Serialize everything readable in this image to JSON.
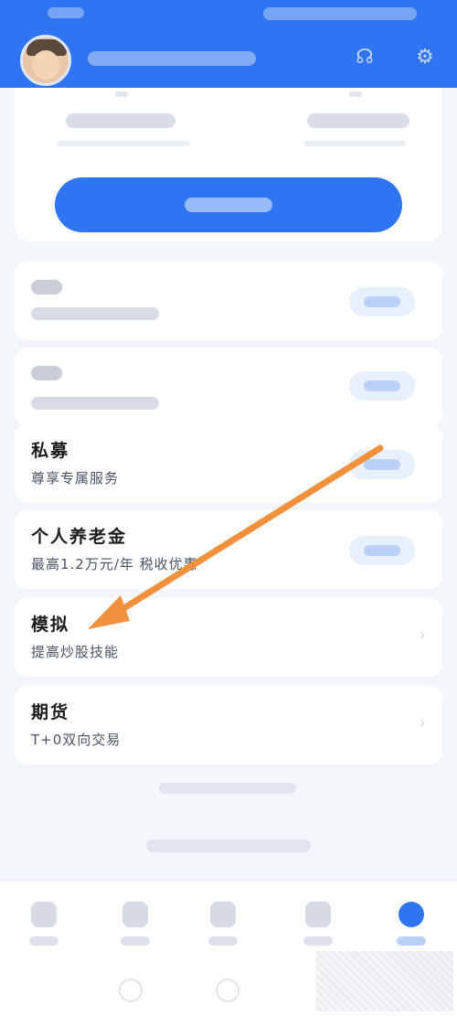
{
  "services": [
    {
      "title": "私募",
      "subtitle": "尊享专属服务"
    },
    {
      "title": "个人养老金",
      "subtitle": "最高1.2万元/年 税收优惠"
    },
    {
      "title": "模拟",
      "subtitle": "提高炒股技能"
    },
    {
      "title": "期货",
      "subtitle": "T+0双向交易"
    }
  ],
  "colors": {
    "primary": "#2f74f0",
    "annotation_arrow": "#f2913d"
  },
  "icons": [
    "avatar",
    "customer-service-icon",
    "settings-icon"
  ]
}
